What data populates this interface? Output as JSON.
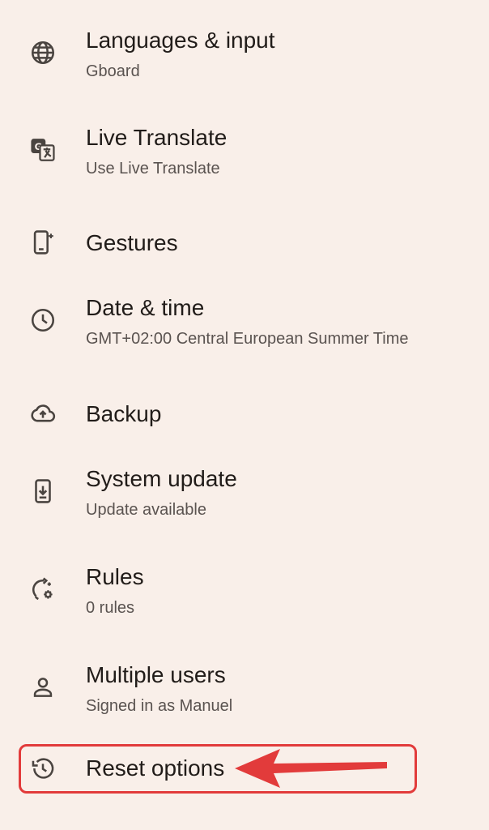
{
  "items": [
    {
      "title": "Languages & input",
      "subtitle": "Gboard",
      "icon": "globe-icon"
    },
    {
      "title": "Live Translate",
      "subtitle": "Use Live Translate",
      "icon": "translate-icon"
    },
    {
      "title": "Gestures",
      "subtitle": "",
      "icon": "gesture-phone-icon"
    },
    {
      "title": "Date & time",
      "subtitle": "GMT+02:00 Central European Summer Time",
      "icon": "clock-icon"
    },
    {
      "title": "Backup",
      "subtitle": "",
      "icon": "cloud-upload-icon"
    },
    {
      "title": "System update",
      "subtitle": "Update available",
      "icon": "system-update-icon"
    },
    {
      "title": "Rules",
      "subtitle": "0 rules",
      "icon": "rules-icon"
    },
    {
      "title": "Multiple users",
      "subtitle": "Signed in as Manuel",
      "icon": "person-icon"
    },
    {
      "title": "Reset options",
      "subtitle": "",
      "icon": "history-icon"
    }
  ],
  "annotation": {
    "color": "#e23b3b"
  }
}
